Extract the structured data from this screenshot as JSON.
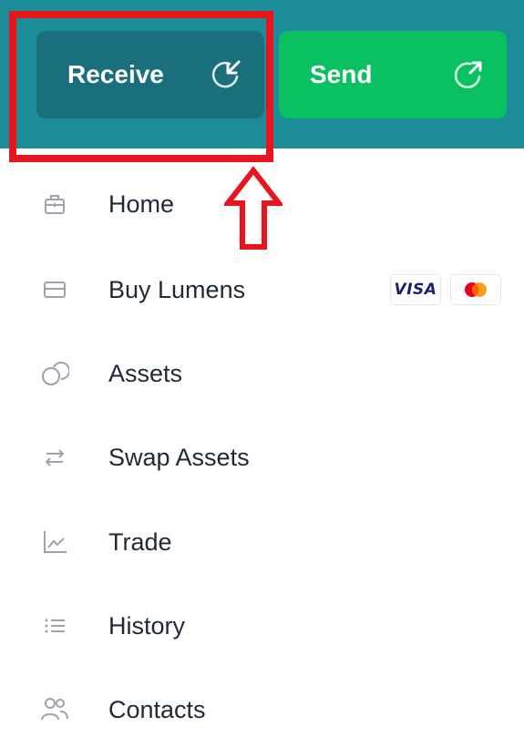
{
  "header": {
    "receive_button": {
      "label": "Receive",
      "icon": "receive-arrow-icon",
      "color": "#196f7b"
    },
    "send_button": {
      "label": "Send",
      "icon": "send-arrow-icon",
      "color": "#0ac161"
    },
    "background_color": "#1b8c98"
  },
  "annotation": {
    "highlight_color": "#e8141e",
    "arrow": "up-arrow-outline"
  },
  "menu": {
    "items": [
      {
        "label": "Home",
        "icon": "briefcase-icon"
      },
      {
        "label": "Buy Lumens",
        "icon": "credit-card-icon",
        "badges": [
          "VISA",
          "mastercard"
        ]
      },
      {
        "label": "Assets",
        "icon": "coins-icon"
      },
      {
        "label": "Swap Assets",
        "icon": "swap-arrows-icon"
      },
      {
        "label": "Trade",
        "icon": "line-chart-icon"
      },
      {
        "label": "History",
        "icon": "list-icon"
      },
      {
        "label": "Contacts",
        "icon": "people-icon"
      }
    ],
    "badges": {
      "visa_label": "VISA"
    }
  }
}
